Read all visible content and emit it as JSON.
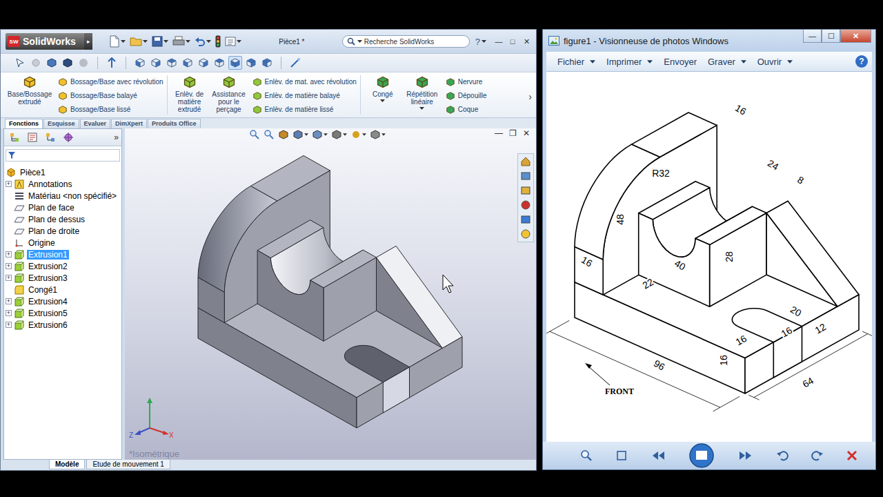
{
  "solidworks": {
    "title_bar": {
      "logo_badge": "SW",
      "logo": "SolidWorks",
      "logo_arrow": "▸",
      "document": "Pièce1 *",
      "search_placeholder": "Recherche SolidWorks",
      "help": "?",
      "window_buttons": [
        "—",
        "□",
        "✕"
      ]
    },
    "view_buttons": [
      {
        "pressed": false
      },
      {
        "pressed": false
      },
      {
        "pressed": false
      },
      {
        "pressed": false
      },
      {
        "pressed": false
      },
      {
        "pressed": false
      },
      {
        "pressed": true
      },
      {
        "pressed": false
      },
      {
        "pressed": false
      }
    ],
    "ribbon": [
      {
        "large": [
          {
            "label": "Base/Bossage extrudé",
            "dropdown": false
          }
        ],
        "small": [
          "Bossage/Base avec révolution",
          "Bossage/Base balayé",
          "Bossage/Base lissé"
        ]
      },
      {
        "large": [
          {
            "label": "Enlèv. de matière extrudé",
            "dropdown": false
          },
          {
            "label": "Assistance pour le perçage",
            "dropdown": false
          }
        ],
        "small": [
          "Enlèv. de mat. avec révolution",
          "Enlèv. de matière balayé",
          "Enlèv. de matière lissé"
        ]
      },
      {
        "large": [
          {
            "label": "Congé",
            "dropdown": true
          },
          {
            "label": "Répétition linéaire",
            "dropdown": true
          }
        ],
        "small": [
          "Nervure",
          "Dépouille",
          "Coque"
        ]
      }
    ],
    "ribbon_more": "›",
    "tabs": [
      {
        "label": "Fonctions",
        "selected": true
      },
      {
        "label": "Esquisse",
        "selected": false
      },
      {
        "label": "Evaluer",
        "selected": false
      },
      {
        "label": "DimXpert",
        "selected": false
      },
      {
        "label": "Produits Office",
        "selected": false
      }
    ],
    "panel_more": "»",
    "tree": [
      {
        "label": "Pièce1",
        "kind": "part",
        "selected": false
      },
      {
        "label": "Annotations",
        "kind": "annotations",
        "expander": "+",
        "selected": false
      },
      {
        "label": "Matériau <non spécifié>",
        "kind": "material",
        "selected": false
      },
      {
        "label": "Plan de face",
        "kind": "plane",
        "selected": false
      },
      {
        "label": "Plan de dessus",
        "kind": "plane",
        "selected": false
      },
      {
        "label": "Plan de droite",
        "kind": "plane",
        "selected": false
      },
      {
        "label": "Origine",
        "kind": "origin",
        "selected": false
      },
      {
        "label": "Extrusion1",
        "kind": "extrude",
        "expander": "+",
        "selected": true
      },
      {
        "label": "Extrusion2",
        "kind": "extrude",
        "expander": "+",
        "selected": false
      },
      {
        "label": "Extrusion3",
        "kind": "extrude",
        "expander": "+",
        "selected": false
      },
      {
        "label": "Congé1",
        "kind": "fillet",
        "selected": false
      },
      {
        "label": "Extrusion4",
        "kind": "extrude",
        "expander": "+",
        "selected": false
      },
      {
        "label": "Extrusion5",
        "kind": "extrude",
        "expander": "+",
        "selected": false
      },
      {
        "label": "Extrusion6",
        "kind": "extrude",
        "expander": "+",
        "selected": false
      }
    ],
    "graphics_window_buttons": [
      "—",
      "❐",
      "✕"
    ],
    "view_name": "*Isométrique",
    "triad": [
      "Z",
      "X"
    ],
    "bottom_tabs": [
      {
        "label": "Modèle",
        "selected": true
      },
      {
        "label": "Etude de mouvement 1",
        "selected": false
      }
    ]
  },
  "photo_viewer": {
    "title": "figure1 - Visionneuse de photos Windows",
    "window_buttons": [
      "—",
      "☐",
      "✕"
    ],
    "menus": [
      {
        "label": "Fichier",
        "dropdown": true
      },
      {
        "label": "Imprimer",
        "dropdown": true
      },
      {
        "label": "Envoyer",
        "dropdown": false
      },
      {
        "label": "Graver",
        "dropdown": true
      },
      {
        "label": "Ouvrir",
        "dropdown": true
      }
    ],
    "help": "?",
    "figure": {
      "dimensions": [
        "16",
        "R32",
        "24",
        "8",
        "48",
        "16",
        "28",
        "40",
        "22",
        "20",
        "16",
        "16",
        "12",
        "16",
        "96",
        "64"
      ],
      "caption": "FRONT"
    }
  }
}
